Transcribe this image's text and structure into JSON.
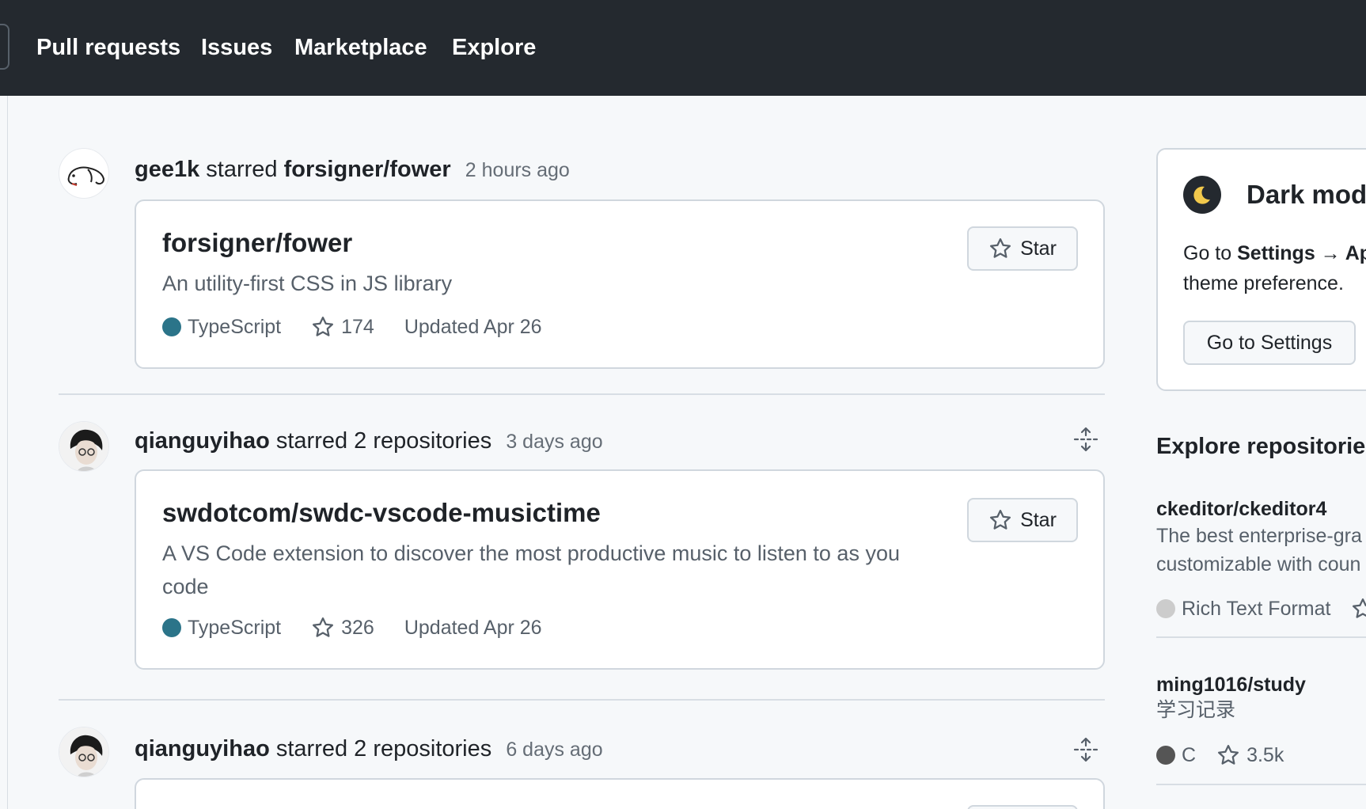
{
  "nav": {
    "items": [
      {
        "label": "Pull requests"
      },
      {
        "label": "Issues"
      },
      {
        "label": "Marketplace"
      },
      {
        "label": "Explore"
      }
    ]
  },
  "feed": [
    {
      "user": "gee1k",
      "action": "starred",
      "target": "forsigner/fower",
      "time": "2 hours ago",
      "repo": {
        "name": "forsigner/fower",
        "description": "An utility-first CSS in JS library",
        "language": "TypeScript",
        "language_color": "#3178c6",
        "stars": "174",
        "updated": "Updated Apr 26",
        "star_label": "Star"
      }
    },
    {
      "user": "qianguyihao",
      "action": "starred 2 repositories",
      "time": "3 days ago",
      "repo": {
        "name": "swdotcom/swdc-vscode-musictime",
        "description": "A VS Code extension to discover the most productive music to listen to as you code",
        "language": "TypeScript",
        "language_color": "#3178c6",
        "stars": "326",
        "updated": "Updated Apr 26",
        "star_label": "Star"
      }
    },
    {
      "user": "qianguyihao",
      "action": "starred 2 repositories",
      "time": "6 days ago"
    }
  ],
  "sidebar": {
    "dark_mode": {
      "title": "Dark mode",
      "text_prefix": "Go to",
      "text_bold": "Settings → Ap",
      "text_line2": "theme preference.",
      "button_label": "Go to Settings"
    },
    "explore": {
      "title": "Explore repositories",
      "repos": [
        {
          "name": "ckeditor/ckeditor4",
          "description_line1": "The best enterprise-gra",
          "description_line2": "customizable with coun",
          "language": "Rich Text Format",
          "language_color": "#cccccc"
        },
        {
          "name": "ming1016/study",
          "description_line1": "学习记录",
          "language": "C",
          "language_color": "#555555",
          "stars": "3.5k"
        }
      ]
    }
  }
}
